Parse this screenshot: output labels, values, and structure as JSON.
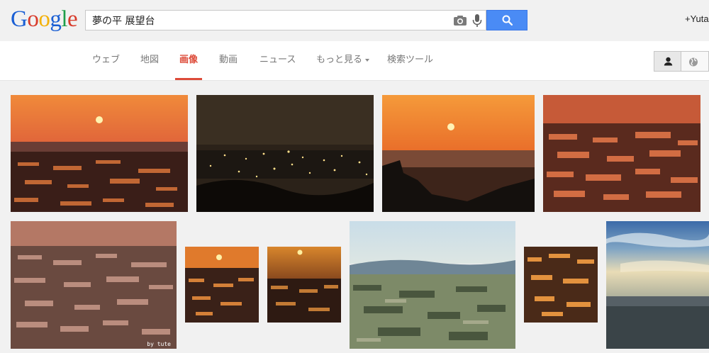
{
  "logo": {
    "letters": [
      "G",
      "o",
      "o",
      "g",
      "l",
      "e"
    ],
    "colors": [
      "#1a5fd4",
      "#d83b2b",
      "#f3b109",
      "#1a5fd4",
      "#1e9e4a",
      "#d83b2b"
    ]
  },
  "search": {
    "query": "夢の平 展望台"
  },
  "header": {
    "user_link": "+Yuta"
  },
  "tabs": {
    "web": "ウェブ",
    "maps": "地図",
    "images": "画像",
    "videos": "動画",
    "news": "ニュース",
    "more": "もっと見る",
    "tools": "検索ツール"
  },
  "colors": {
    "active_tab": "#dd4b39",
    "search_button": "#4a8bf5"
  },
  "results": {
    "watermark": "by tute",
    "images": [
      "sunset-over-rice-terraces",
      "night-city-lights",
      "sunset-sun-silhouette-trees",
      "red-sunset-rice-terraces",
      "hazy-rice-terraces",
      "small-sunset-terraces-1",
      "small-sunset-terraces-2",
      "daytime-valley-view",
      "small-sunset-terraces-3",
      "sky-clouds-valley"
    ]
  }
}
